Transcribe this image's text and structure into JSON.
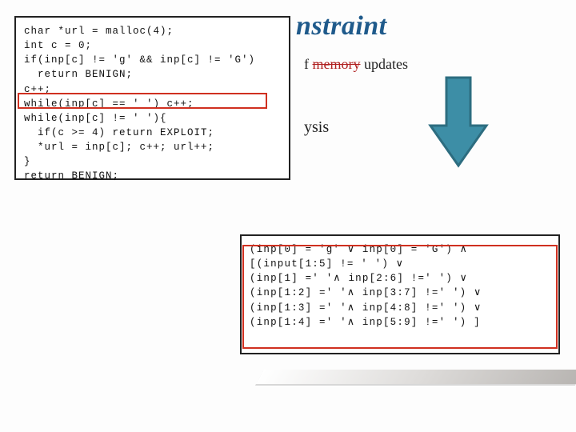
{
  "title_fragment": "nstraint",
  "bullet1": {
    "prefix": "f ",
    "strike": "memory",
    "suffix": " updates"
  },
  "bullet2_fragment": "ysis",
  "code_top": "char *url = malloc(4);\nint c = 0;\nif(inp[c] != 'g' && inp[c] != 'G')\n  return BENIGN;\nc++;\nwhile(inp[c] == ' ') c++;\nwhile(inp[c] != ' '){\n  if(c >= 4) return EXPLOIT;\n  *url = inp[c]; c++; url++;\n}\nreturn BENIGN;",
  "code_bottom": "(inp[0] = 'g' ∨ inp[0] = 'G') ∧\n[(input[1:5] != ' ') ∨\n(inp[1] =' '∧ inp[2:6] !=' ') ∨\n(inp[1:2] =' '∧ inp[3:7] !=' ') ∨\n(inp[1:3] =' '∧ inp[4:8] !=' ') ∨\n(inp[1:4] =' '∧ inp[5:9] !=' ') ]",
  "colors": {
    "title": "#1f5a8b",
    "highlight": "#d03020",
    "arrow_fill": "#3d8ea6",
    "arrow_stroke": "#2d6d80"
  }
}
